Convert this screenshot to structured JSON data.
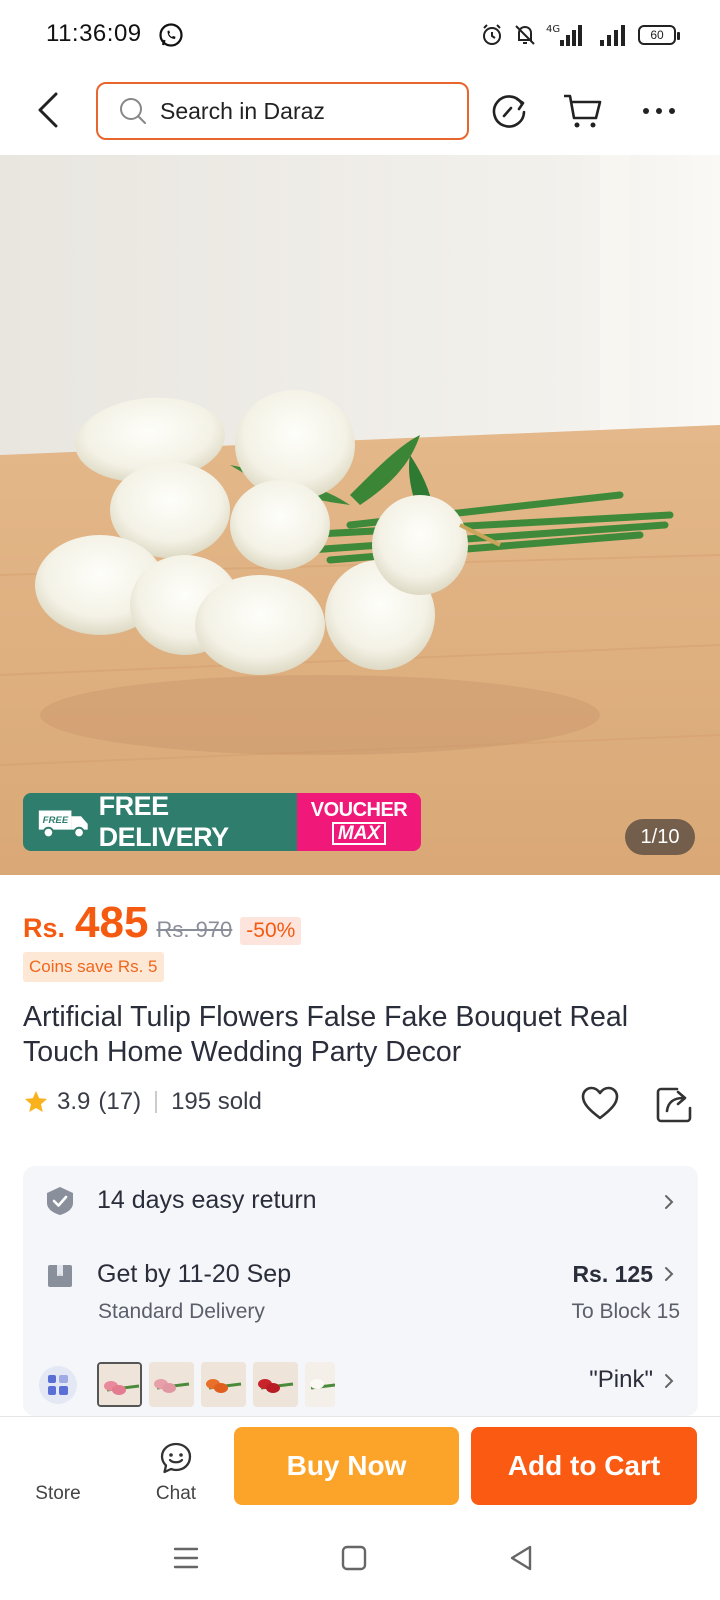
{
  "status_bar": {
    "time": "11:36:09",
    "network": "4G",
    "battery": "60"
  },
  "header": {
    "search_placeholder": "Search in Daraz"
  },
  "hero": {
    "counter": "1/10",
    "promo_free_badge": "FREE",
    "promo_free_delivery": "FREE DELIVERY",
    "promo_voucher": "VOUCHER",
    "promo_max": "MAX"
  },
  "product": {
    "currency": "Rs.",
    "price": "485",
    "original_price": "Rs. 970",
    "discount": "-50%",
    "coins": "Coins save Rs. 5",
    "title": "Artificial Tulip Flowers False Fake Bouquet Real Touch Home Wedding Party Decor",
    "rating": "3.9",
    "reviews": "(17)",
    "sold": "195 sold"
  },
  "info": {
    "return_policy": "14 days easy return",
    "delivery_date": "Get by 11-20 Sep",
    "delivery_type": "Standard Delivery",
    "delivery_fee": "Rs. 125",
    "delivery_location": "To Block 15",
    "variant": "\"Pink\"",
    "swatch_colors": [
      "#e88a9a",
      "#e7a0a8",
      "#e8702a",
      "#c8242c",
      "#f3efe8"
    ]
  },
  "actions": {
    "store": "Store",
    "chat": "Chat",
    "buy_now": "Buy Now",
    "add_to_cart": "Add to Cart"
  },
  "colors": {
    "accent_orange": "#fa5a12",
    "buy_now_yellow": "#fca42a",
    "promo_green": "#2f7d6d",
    "voucher_pink": "#f01878"
  }
}
